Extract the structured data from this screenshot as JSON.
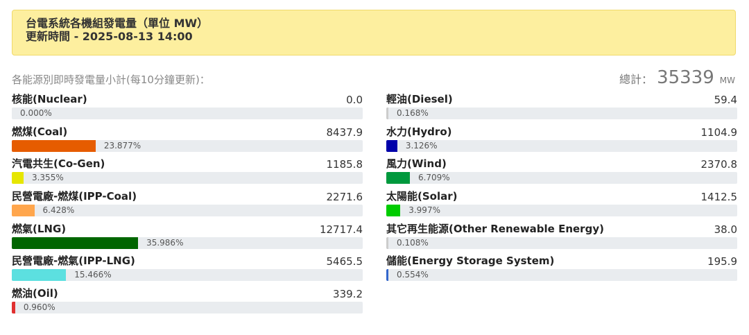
{
  "header": {
    "title": "台電系統各機組發電量（單位 MW）",
    "updated": "更新時間 - 2025-08-13 14:00"
  },
  "summary": {
    "subtitle": "各能源別即時發電量小計(每10分鐘更新)：",
    "total_label": "總計：",
    "total_value": "35339",
    "total_unit": "MW"
  },
  "sources_left": [
    {
      "name": "核能(Nuclear)",
      "value": "0.0",
      "percent": 0.0,
      "percent_label": "0.000%",
      "color": "#cccccc"
    },
    {
      "name": "燃煤(Coal)",
      "value": "8437.9",
      "percent": 23.877,
      "percent_label": "23.877%",
      "color": "#e65c00"
    },
    {
      "name": "汽電共生(Co-Gen)",
      "value": "1185.8",
      "percent": 3.355,
      "percent_label": "3.355%",
      "color": "#e6e600"
    },
    {
      "name": "民營電廠-燃煤(IPP-Coal)",
      "value": "2271.6",
      "percent": 6.428,
      "percent_label": "6.428%",
      "color": "#ffa64d"
    },
    {
      "name": "燃氣(LNG)",
      "value": "12717.4",
      "percent": 35.986,
      "percent_label": "35.986%",
      "color": "#006600"
    },
    {
      "name": "民營電廠-燃氣(IPP-LNG)",
      "value": "5465.5",
      "percent": 15.466,
      "percent_label": "15.466%",
      "color": "#5ce0e0"
    },
    {
      "name": "燃油(Oil)",
      "value": "339.2",
      "percent": 0.96,
      "percent_label": "0.960%",
      "color": "#e03030"
    }
  ],
  "sources_right": [
    {
      "name": "輕油(Diesel)",
      "value": "59.4",
      "percent": 0.168,
      "percent_label": "0.168%",
      "color": "#cccccc"
    },
    {
      "name": "水力(Hydro)",
      "value": "1104.9",
      "percent": 3.126,
      "percent_label": "3.126%",
      "color": "#0000aa"
    },
    {
      "name": "風力(Wind)",
      "value": "2370.8",
      "percent": 6.709,
      "percent_label": "6.709%",
      "color": "#00993d"
    },
    {
      "name": "太陽能(Solar)",
      "value": "1412.5",
      "percent": 3.997,
      "percent_label": "3.997%",
      "color": "#00cc00"
    },
    {
      "name": "其它再生能源(Other Renewable Energy)",
      "value": "38.0",
      "percent": 0.108,
      "percent_label": "0.108%",
      "color": "#cccccc"
    },
    {
      "name": "儲能(Energy Storage System)",
      "value": "195.9",
      "percent": 0.554,
      "percent_label": "0.554%",
      "color": "#3366cc"
    }
  ]
}
